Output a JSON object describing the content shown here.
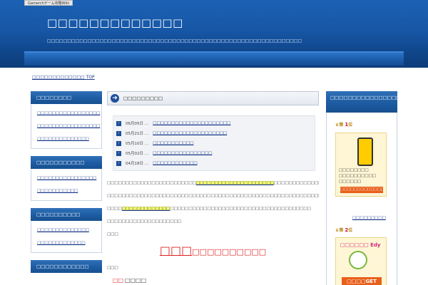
{
  "header": {
    "tag": "Gamerchゲーム攻略Wiki",
    "title": "□□□□□□□□□□□□□",
    "description": "□□□□□□□□□□□□□□□□□□□□□□□□□□□□□□□□□□□□□□□□□□□□□□□□□□□□□□□□□□□□□□□"
  },
  "breadcrumb": {
    "label": "□□□□□□□□□□□□□ TOP"
  },
  "sidebar": [
    {
      "title": "□□□□□□□□",
      "links": [
        "□□□□□□□□□□□□□□□□□",
        "□□□□□□□□□□□□□□□□□",
        "□□□□□□□□□□□□□□"
      ]
    },
    {
      "title": "□□□□□□□□□□□",
      "links": [
        "□□□□□□□□□□□□□□□□",
        "□□□□□□□□□□□"
      ]
    },
    {
      "title": "□□□□□□□□□□",
      "links": [
        "□□□□□□□□□□□□□□",
        "□□□□□□□□□□□□□"
      ]
    },
    {
      "title": "□□□□□□□□□□□□"
    }
  ],
  "content": {
    "heading": "□□□□□□□□□",
    "news": [
      {
        "date": "06月05日 …",
        "title": "□□□□□□□□□□□□□□□□□□□□□"
      },
      {
        "date": "05月21日 …",
        "title": "□□□□□□□□□□□□□□□□□□□□"
      },
      {
        "date": "05月10日 …",
        "title": "□□□□□□□□□□□"
      },
      {
        "date": "05月02日 …",
        "title": "□□□□□□□□□□□□□□□□"
      },
      {
        "date": "04月18日 …",
        "title": "□□□□□□□□□□□□"
      }
    ],
    "para1_a": "□□□□□□□□□□□□□□□□□□□□□□□□",
    "para1_hl": "□□□□□□□□□□□□□□□□□□□□□",
    "para1_b": "□□□□□□□□□□□□□□□□□□□□□",
    "para2": "□□□□□□□□□□□□□□□□□□□□□□□□□□□□□□□□□□□□□□□□□□□□□□□□□□□□□□□□□□□□",
    "para3_a": "□□□□",
    "para3_hl": "□□□□□□□□□□□□□",
    "para3_b": "□□□□□□□□□□□□□□□□□□□□□□□□□□□□□□□□□□□□□□",
    "para4": "□□□□□□□□□□□□□□□□□□□□",
    "para5": "□□□",
    "big_a": "□□□",
    "big_b": "□□□□□□□□□□",
    "para6": "□□□",
    "red_a": "□□",
    "red_b": "□□□□"
  },
  "right_sidebar": {
    "title": "□□□□□□□□□□□□□□□□□□□□□□□□↓",
    "rank1_label": "第",
    "rank1_num": "1",
    "rank1_suffix": "位",
    "ad1_text": "□□□□□□□□\n□□□□□□□□□□\n□□□□□□",
    "ad1_button": "□□□□□□□□□□□□□",
    "ad1_link": "□□□□□□□□□",
    "rank2_label": "第",
    "rank2_num": "2",
    "rank2_suffix": "位",
    "ad2_text": "□□□□□□ Edy",
    "ad2_button": "□□□□GET"
  }
}
